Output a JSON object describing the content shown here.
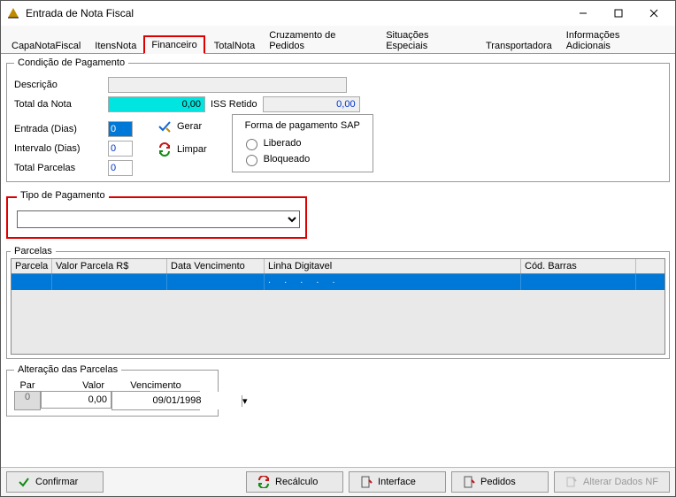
{
  "window": {
    "title": "Entrada de Nota Fiscal"
  },
  "tabs": {
    "capa": "CapaNotaFiscal",
    "itens": "ItensNota",
    "financeiro": "Financeiro",
    "total": "TotalNota",
    "cruz": "Cruzamento de Pedidos",
    "sit": "Situações Especiais",
    "transp": "Transportadora",
    "info": "Informações Adicionais"
  },
  "cond": {
    "legend": "Condição de Pagamento",
    "descricao_label": "Descrição",
    "descricao_value": "",
    "total_nota_label": "Total da Nota",
    "total_nota_value": "0,00",
    "iss_label": "ISS Retido",
    "iss_value": "0,00",
    "entrada_label": "Entrada (Dias)",
    "entrada_value": "0",
    "intervalo_label": "Intervalo (Dias)",
    "intervalo_value": "0",
    "total_parcelas_label": "Total Parcelas",
    "total_parcelas_value": "0",
    "gerar_label": "Gerar",
    "limpar_label": "Limpar",
    "sap": {
      "legend": "Forma de pagamento SAP",
      "liberado": "Liberado",
      "bloqueado": "Bloqueado"
    }
  },
  "tipo": {
    "legend": "Tipo de Pagamento",
    "value": ""
  },
  "parcelas": {
    "legend": "Parcelas",
    "head": {
      "parcela": "Parcela",
      "valor": "Valor Parcela R$",
      "venc": "Data Vencimento",
      "linha": "Linha Digitavel",
      "cod": "Cód. Barras"
    },
    "row1": {
      "parcela": "",
      "valor": "",
      "venc": "",
      "linha": ".   .   .   .   .",
      "cod": ""
    }
  },
  "alter": {
    "legend": "Alteração das Parcelas",
    "head": {
      "par": "Par",
      "valor": "Valor",
      "venc": "Vencimento"
    },
    "body": {
      "par": "0",
      "valor": "0,00",
      "venc": "09/01/1998"
    }
  },
  "footer": {
    "confirmar": "Confirmar",
    "recalculo": "Recálculo",
    "interface": "Interface",
    "pedidos": "Pedidos",
    "alterar": "Alterar Dados NF"
  }
}
